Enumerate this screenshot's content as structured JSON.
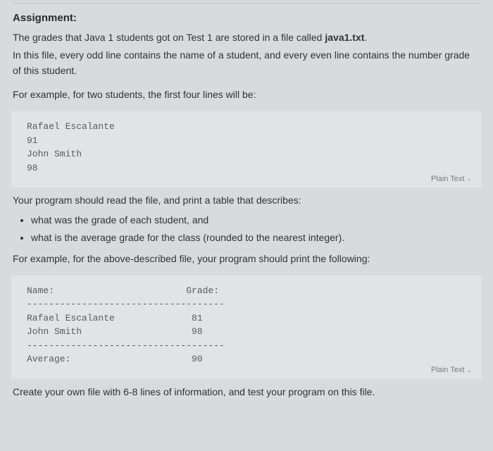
{
  "heading": "Assignment:",
  "intro": {
    "line1_a": "The grades that Java 1 students got on Test 1 are stored in a file called ",
    "line1_b": "java1.txt",
    "line1_c": ".",
    "line2": "In this file, every odd line contains the name of a student, and every even line contains the number grade of this student.",
    "line3": "For example, for two students, the first four lines will be:"
  },
  "code1": {
    "l1": "Rafael Escalante",
    "l2": "91",
    "l3": "John Smith",
    "l4": "98",
    "lang": "Plain Text"
  },
  "program": {
    "lead": "Your program should read the file, and print a table that describes:",
    "b1": "what was the grade of each student, and",
    "b2": "what is the average grade for the class (rounded to the nearest integer).",
    "lead2": "For example, for the above-described file, your program should print the following:"
  },
  "code2": {
    "l1": "Name:                        Grade:",
    "l2": "------------------------------------",
    "l3": "Rafael Escalante              81",
    "l4": "John Smith                    98",
    "l5": "------------------------------------",
    "l6": "Average:                      90",
    "lang": "Plain Text"
  },
  "footer": "Create your own file with 6-8 lines of information, and test your program on this file."
}
